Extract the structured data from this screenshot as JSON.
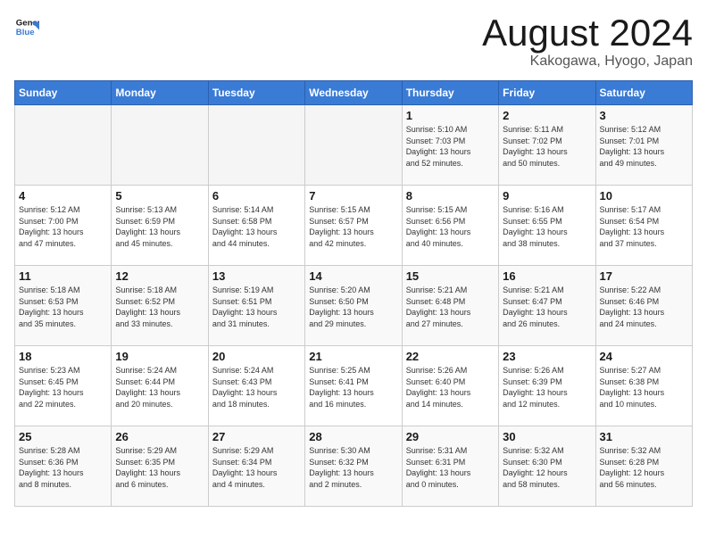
{
  "logo": {
    "line1": "General",
    "line2": "Blue"
  },
  "title": "August 2024",
  "location": "Kakogawa, Hyogo, Japan",
  "weekdays": [
    "Sunday",
    "Monday",
    "Tuesday",
    "Wednesday",
    "Thursday",
    "Friday",
    "Saturday"
  ],
  "weeks": [
    [
      {
        "day": "",
        "info": ""
      },
      {
        "day": "",
        "info": ""
      },
      {
        "day": "",
        "info": ""
      },
      {
        "day": "",
        "info": ""
      },
      {
        "day": "1",
        "info": "Sunrise: 5:10 AM\nSunset: 7:03 PM\nDaylight: 13 hours\nand 52 minutes."
      },
      {
        "day": "2",
        "info": "Sunrise: 5:11 AM\nSunset: 7:02 PM\nDaylight: 13 hours\nand 50 minutes."
      },
      {
        "day": "3",
        "info": "Sunrise: 5:12 AM\nSunset: 7:01 PM\nDaylight: 13 hours\nand 49 minutes."
      }
    ],
    [
      {
        "day": "4",
        "info": "Sunrise: 5:12 AM\nSunset: 7:00 PM\nDaylight: 13 hours\nand 47 minutes."
      },
      {
        "day": "5",
        "info": "Sunrise: 5:13 AM\nSunset: 6:59 PM\nDaylight: 13 hours\nand 45 minutes."
      },
      {
        "day": "6",
        "info": "Sunrise: 5:14 AM\nSunset: 6:58 PM\nDaylight: 13 hours\nand 44 minutes."
      },
      {
        "day": "7",
        "info": "Sunrise: 5:15 AM\nSunset: 6:57 PM\nDaylight: 13 hours\nand 42 minutes."
      },
      {
        "day": "8",
        "info": "Sunrise: 5:15 AM\nSunset: 6:56 PM\nDaylight: 13 hours\nand 40 minutes."
      },
      {
        "day": "9",
        "info": "Sunrise: 5:16 AM\nSunset: 6:55 PM\nDaylight: 13 hours\nand 38 minutes."
      },
      {
        "day": "10",
        "info": "Sunrise: 5:17 AM\nSunset: 6:54 PM\nDaylight: 13 hours\nand 37 minutes."
      }
    ],
    [
      {
        "day": "11",
        "info": "Sunrise: 5:18 AM\nSunset: 6:53 PM\nDaylight: 13 hours\nand 35 minutes."
      },
      {
        "day": "12",
        "info": "Sunrise: 5:18 AM\nSunset: 6:52 PM\nDaylight: 13 hours\nand 33 minutes."
      },
      {
        "day": "13",
        "info": "Sunrise: 5:19 AM\nSunset: 6:51 PM\nDaylight: 13 hours\nand 31 minutes."
      },
      {
        "day": "14",
        "info": "Sunrise: 5:20 AM\nSunset: 6:50 PM\nDaylight: 13 hours\nand 29 minutes."
      },
      {
        "day": "15",
        "info": "Sunrise: 5:21 AM\nSunset: 6:48 PM\nDaylight: 13 hours\nand 27 minutes."
      },
      {
        "day": "16",
        "info": "Sunrise: 5:21 AM\nSunset: 6:47 PM\nDaylight: 13 hours\nand 26 minutes."
      },
      {
        "day": "17",
        "info": "Sunrise: 5:22 AM\nSunset: 6:46 PM\nDaylight: 13 hours\nand 24 minutes."
      }
    ],
    [
      {
        "day": "18",
        "info": "Sunrise: 5:23 AM\nSunset: 6:45 PM\nDaylight: 13 hours\nand 22 minutes."
      },
      {
        "day": "19",
        "info": "Sunrise: 5:24 AM\nSunset: 6:44 PM\nDaylight: 13 hours\nand 20 minutes."
      },
      {
        "day": "20",
        "info": "Sunrise: 5:24 AM\nSunset: 6:43 PM\nDaylight: 13 hours\nand 18 minutes."
      },
      {
        "day": "21",
        "info": "Sunrise: 5:25 AM\nSunset: 6:41 PM\nDaylight: 13 hours\nand 16 minutes."
      },
      {
        "day": "22",
        "info": "Sunrise: 5:26 AM\nSunset: 6:40 PM\nDaylight: 13 hours\nand 14 minutes."
      },
      {
        "day": "23",
        "info": "Sunrise: 5:26 AM\nSunset: 6:39 PM\nDaylight: 13 hours\nand 12 minutes."
      },
      {
        "day": "24",
        "info": "Sunrise: 5:27 AM\nSunset: 6:38 PM\nDaylight: 13 hours\nand 10 minutes."
      }
    ],
    [
      {
        "day": "25",
        "info": "Sunrise: 5:28 AM\nSunset: 6:36 PM\nDaylight: 13 hours\nand 8 minutes."
      },
      {
        "day": "26",
        "info": "Sunrise: 5:29 AM\nSunset: 6:35 PM\nDaylight: 13 hours\nand 6 minutes."
      },
      {
        "day": "27",
        "info": "Sunrise: 5:29 AM\nSunset: 6:34 PM\nDaylight: 13 hours\nand 4 minutes."
      },
      {
        "day": "28",
        "info": "Sunrise: 5:30 AM\nSunset: 6:32 PM\nDaylight: 13 hours\nand 2 minutes."
      },
      {
        "day": "29",
        "info": "Sunrise: 5:31 AM\nSunset: 6:31 PM\nDaylight: 13 hours\nand 0 minutes."
      },
      {
        "day": "30",
        "info": "Sunrise: 5:32 AM\nSunset: 6:30 PM\nDaylight: 12 hours\nand 58 minutes."
      },
      {
        "day": "31",
        "info": "Sunrise: 5:32 AM\nSunset: 6:28 PM\nDaylight: 12 hours\nand 56 minutes."
      }
    ]
  ]
}
